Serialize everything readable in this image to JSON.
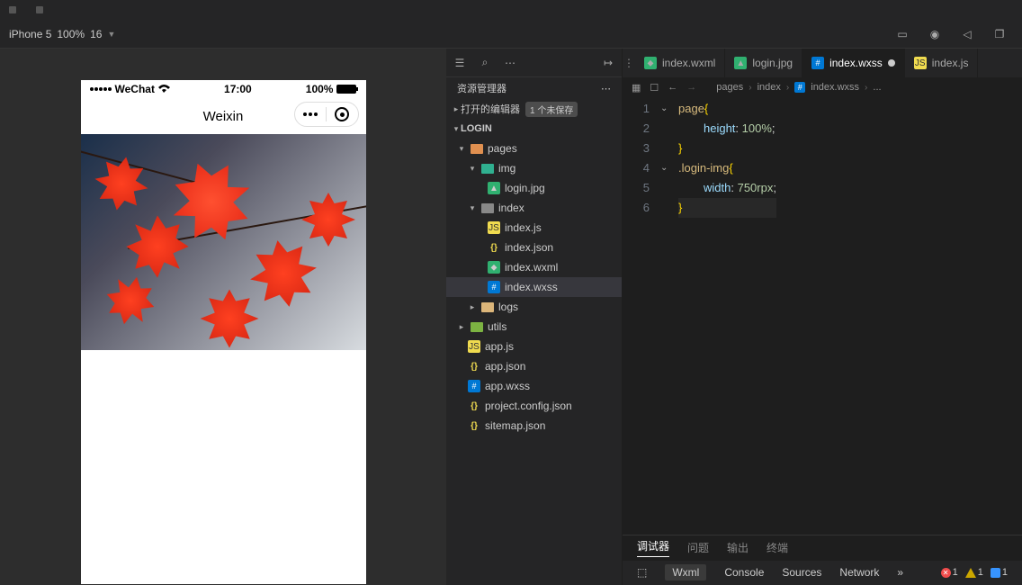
{
  "device": {
    "name": "iPhone 5",
    "zoom": "100%",
    "extra": "16"
  },
  "simulator": {
    "statusbar": {
      "carrier": "WeChat",
      "time": "17:00",
      "battery": "100%"
    },
    "navbar": {
      "title": "Weixin"
    }
  },
  "explorer": {
    "title": "资源管理器",
    "openEditors": {
      "label": "打开的编辑器",
      "badge": "1 个未保存"
    },
    "project": "LOGIN",
    "tree": {
      "pages": "pages",
      "img": "img",
      "loginjpg": "login.jpg",
      "index": "index",
      "indexjs": "index.js",
      "indexjson": "index.json",
      "indexwxml": "index.wxml",
      "indexwxss": "index.wxss",
      "logs": "logs",
      "utils": "utils",
      "appjs": "app.js",
      "appjson": "app.json",
      "appwxss": "app.wxss",
      "projectconfig": "project.config.json",
      "sitemap": "sitemap.json"
    }
  },
  "tabs": {
    "t1": "index.wxml",
    "t2": "login.jpg",
    "t3": "index.wxss",
    "t4": "index.js"
  },
  "breadcrumb": {
    "p1": "pages",
    "p2": "index",
    "p3": "index.wxss",
    "p4": "..."
  },
  "code": {
    "l1_sel": "page",
    "l2_prop": "height",
    "l2_val": "100%",
    "l4_sel": ".login-img",
    "l5_prop": "width",
    "l5_num": "750",
    "l5_unit": "rpx"
  },
  "bottomTabs": {
    "debugger": "调试器",
    "problems": "问题",
    "output": "输出",
    "terminal": "终端"
  },
  "devtools": {
    "wxml": "Wxml",
    "console": "Console",
    "sources": "Sources",
    "network": "Network"
  },
  "status": {
    "err": "1",
    "warn": "1",
    "info": "1"
  }
}
